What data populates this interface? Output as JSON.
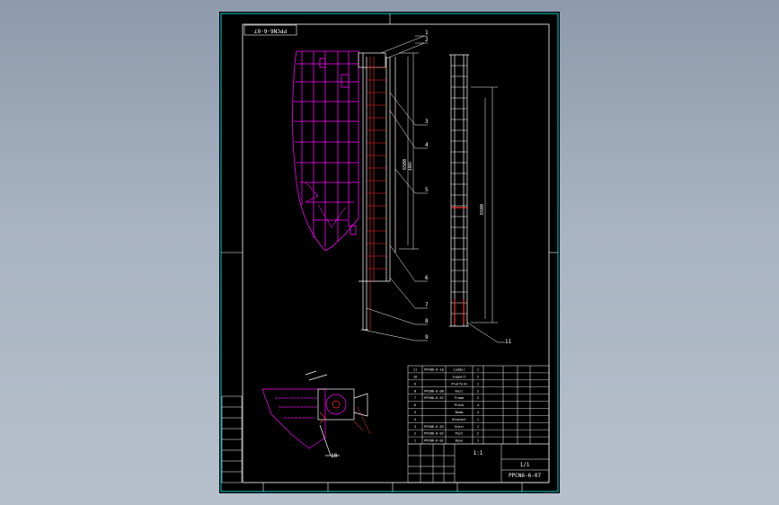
{
  "drawing": {
    "code_rotated": "PPCN6-6-07",
    "code_titleblock": "PPCN6-6-07",
    "scale": "1:1",
    "sheet": "1/1"
  },
  "callouts": [
    "1",
    "2",
    "3",
    "4",
    "5",
    "6",
    "7",
    "8",
    "9",
    "10",
    "11"
  ],
  "dimensions": {
    "d1": "6500",
    "d2": "4800",
    "d3": "6500"
  },
  "bom_rows": [
    {
      "no": "11",
      "code": "PPCN6-6-10",
      "name": "Ladder",
      "qty": "1"
    },
    {
      "no": "10",
      "code": "",
      "name": "Support",
      "qty": "2"
    },
    {
      "no": "9",
      "code": "",
      "name": "Platform",
      "qty": "1"
    },
    {
      "no": "8",
      "code": "PPCN6-6-08",
      "name": "Rail",
      "qty": "2"
    },
    {
      "no": "7",
      "code": "PPCN6-6-07",
      "name": "Frame",
      "qty": "2"
    },
    {
      "no": "6",
      "code": "",
      "name": "Plate",
      "qty": "4"
    },
    {
      "no": "5",
      "code": "",
      "name": "Beam",
      "qty": "4"
    },
    {
      "no": "4",
      "code": "",
      "name": "Bracket",
      "qty": "1"
    },
    {
      "no": "3",
      "code": "PPCN6-6-03",
      "name": "Stair",
      "qty": "1"
    },
    {
      "no": "2",
      "code": "PPCN6-6-02",
      "name": "Post",
      "qty": "2"
    },
    {
      "no": "1",
      "code": "PPCN6-6-01",
      "name": "Base",
      "qty": "1"
    }
  ],
  "colors": {
    "border": "#00d0d0",
    "frame": "#ffffff",
    "hull": "#ff00ff",
    "ladder": "#ffffff",
    "accent": "#ff3030",
    "dim": "#ffffff"
  }
}
